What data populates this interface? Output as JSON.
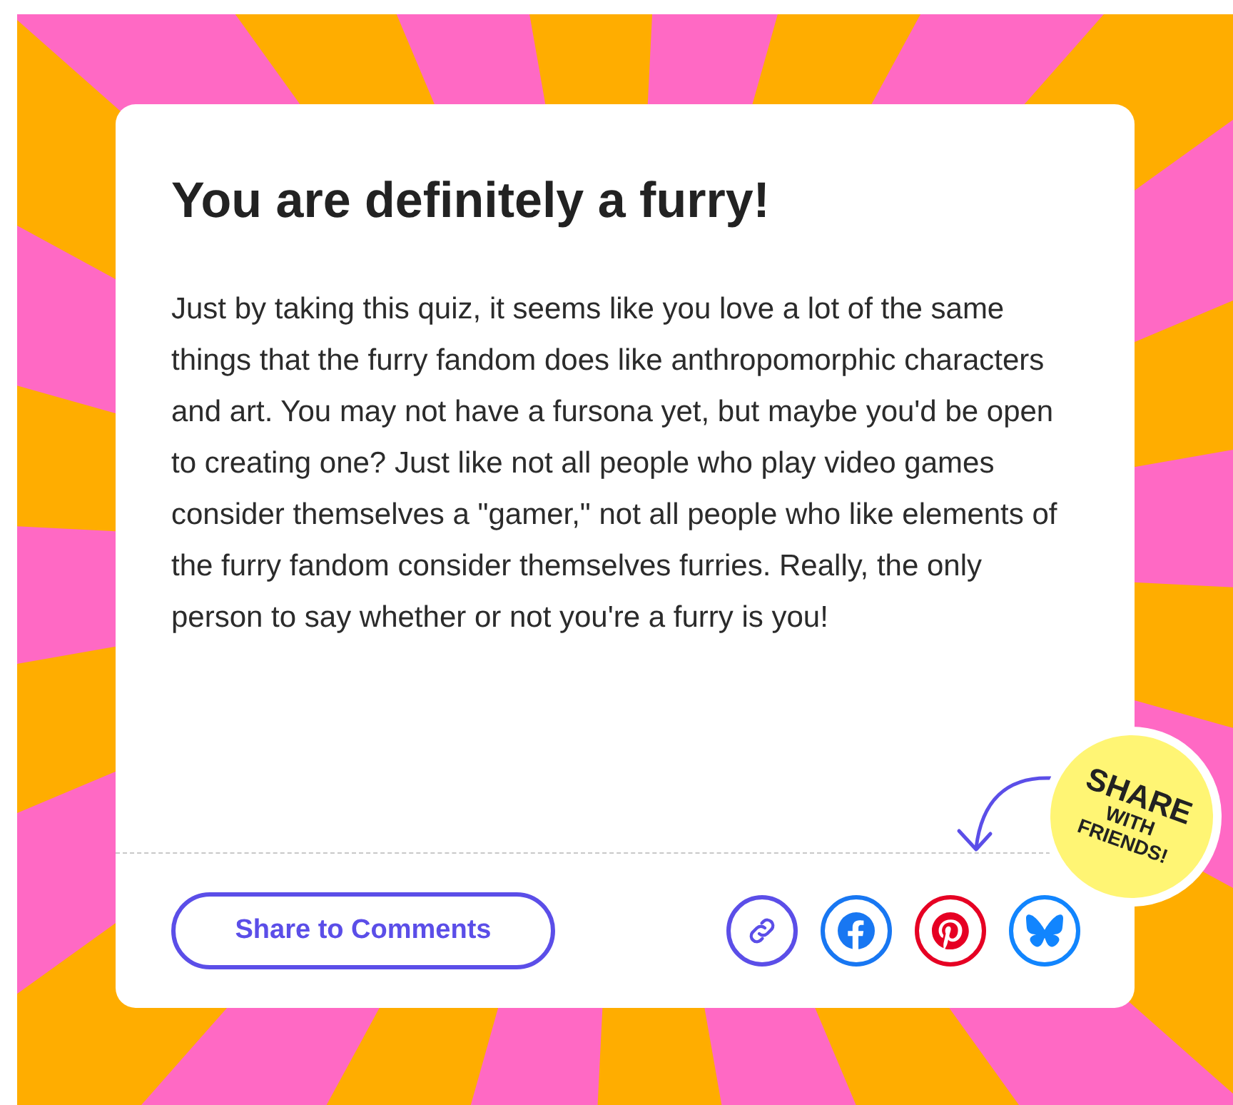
{
  "result": {
    "title": "You are definitely a furry!",
    "description": "Just by taking this quiz, it seems like you love a lot of the same things that the furry fandom does like anthropomorphic characters and art. You may not have a fursona yet, but maybe you'd be open to creating one? Just like not all people who play video games consider themselves a \"gamer,\" not all people who like elements of the furry fandom consider themselves furries. Really, the only person to say whether or not you're a furry is you!"
  },
  "sticker": {
    "lines": [
      "SHARE",
      "WITH",
      "FRIENDS!"
    ]
  },
  "share_button": {
    "label": "Share to Comments"
  },
  "social_buttons": [
    {
      "kind": "link"
    },
    {
      "kind": "facebook"
    },
    {
      "kind": "pinterest"
    },
    {
      "kind": "bluesky"
    }
  ]
}
